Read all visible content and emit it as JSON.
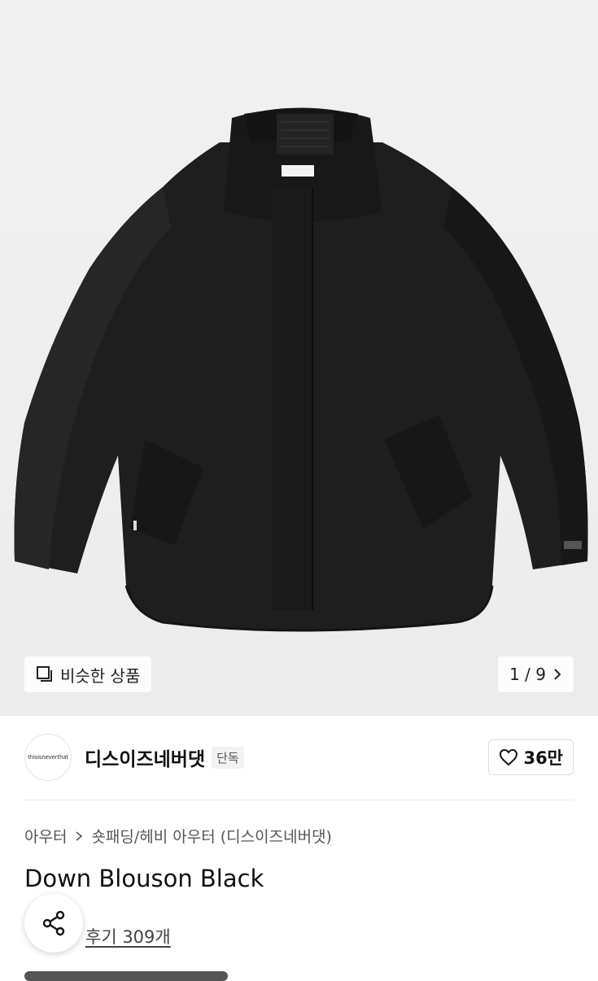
{
  "hero": {
    "similar_label": "비슷한 상품",
    "counter": "1 / 9",
    "icons": {
      "similar": "similar-items-icon",
      "next": "chevron-right-icon"
    }
  },
  "brand": {
    "logo_text": "thisisneverthat",
    "name": "디스이즈네버댓",
    "tag": "단독",
    "likes": "36만",
    "icons": {
      "like": "heart-icon"
    }
  },
  "product": {
    "breadcrumb": [
      "아우터",
      "숏패딩/헤비 아우터 (디스이즈네버댓)"
    ],
    "title": "Down Blouson Black",
    "reviews": "후기 309개",
    "icons": {
      "share": "share-icon",
      "separator": "chevron-right-icon"
    }
  },
  "colors": {
    "hero_bg": "#eeeeee",
    "jacket": "#1d1d1d",
    "text_primary": "#111111",
    "text_secondary": "#555555"
  }
}
